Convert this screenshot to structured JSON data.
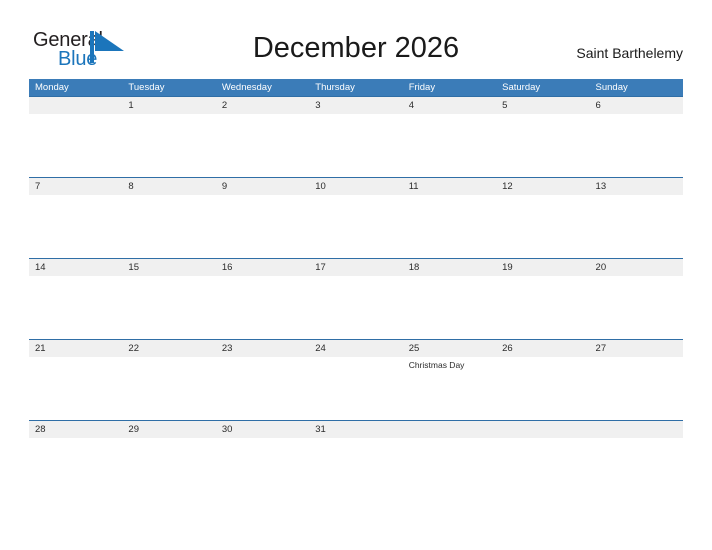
{
  "brand": {
    "name_part1": "General",
    "name_part2": "Blue",
    "flag_icon": "blue-triangle-flag",
    "accent_color": "#1b75bb"
  },
  "header": {
    "title": "December 2026",
    "location": "Saint Barthelemy"
  },
  "colors": {
    "header_blue": "#3b7cb8",
    "row_border_blue": "#2f6ea6",
    "row_band_gray": "#f0f0f0",
    "text": "#2b2b2b",
    "brand_blue": "#1b75bb",
    "brand_dark": "#231f20"
  },
  "calendar": {
    "month": "December",
    "year": "2026",
    "weekdays": [
      "Monday",
      "Tuesday",
      "Wednesday",
      "Thursday",
      "Friday",
      "Saturday",
      "Sunday"
    ],
    "weeks": [
      [
        {
          "day": "",
          "event": ""
        },
        {
          "day": "1",
          "event": ""
        },
        {
          "day": "2",
          "event": ""
        },
        {
          "day": "3",
          "event": ""
        },
        {
          "day": "4",
          "event": ""
        },
        {
          "day": "5",
          "event": ""
        },
        {
          "day": "6",
          "event": ""
        }
      ],
      [
        {
          "day": "7",
          "event": ""
        },
        {
          "day": "8",
          "event": ""
        },
        {
          "day": "9",
          "event": ""
        },
        {
          "day": "10",
          "event": ""
        },
        {
          "day": "11",
          "event": ""
        },
        {
          "day": "12",
          "event": ""
        },
        {
          "day": "13",
          "event": ""
        }
      ],
      [
        {
          "day": "14",
          "event": ""
        },
        {
          "day": "15",
          "event": ""
        },
        {
          "day": "16",
          "event": ""
        },
        {
          "day": "17",
          "event": ""
        },
        {
          "day": "18",
          "event": ""
        },
        {
          "day": "19",
          "event": ""
        },
        {
          "day": "20",
          "event": ""
        }
      ],
      [
        {
          "day": "21",
          "event": ""
        },
        {
          "day": "22",
          "event": ""
        },
        {
          "day": "23",
          "event": ""
        },
        {
          "day": "24",
          "event": ""
        },
        {
          "day": "25",
          "event": "Christmas Day"
        },
        {
          "day": "26",
          "event": ""
        },
        {
          "day": "27",
          "event": ""
        }
      ],
      [
        {
          "day": "28",
          "event": ""
        },
        {
          "day": "29",
          "event": ""
        },
        {
          "day": "30",
          "event": ""
        },
        {
          "day": "31",
          "event": ""
        },
        {
          "day": "",
          "event": ""
        },
        {
          "day": "",
          "event": ""
        },
        {
          "day": "",
          "event": ""
        }
      ]
    ]
  }
}
